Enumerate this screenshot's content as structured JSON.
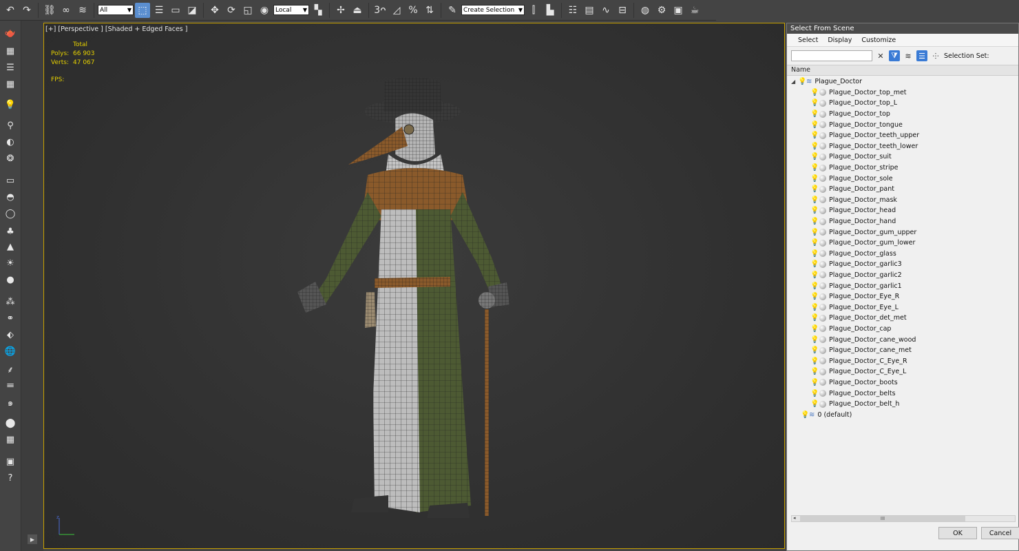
{
  "toolbar": {
    "filter_value": "All",
    "coord_value": "Local",
    "selection_set_placeholder": "Create Selection Se",
    "snap_label": "3",
    "angle_snap_label": "",
    "percent_snap_label": "%"
  },
  "viewport": {
    "label": "[+] [Perspective ] [Shaded + Edged Faces ]",
    "stats": {
      "header": "Total",
      "polys_label": "Polys:",
      "polys_value": "66 903",
      "verts_label": "Verts:",
      "verts_value": "47 067",
      "fps_label": "FPS:"
    },
    "axis_label": "z"
  },
  "dialog": {
    "title": "Select From Scene",
    "menu": [
      "Select",
      "Display",
      "Customize"
    ],
    "selection_set_label": "Selection Set:",
    "column_name": "Name",
    "root": "Plague_Doctor",
    "children": [
      "Plague_Doctor_top_met",
      "Plague_Doctor_top_L",
      "Plague_Doctor_top",
      "Plague_Doctor_tongue",
      "Plague_Doctor_teeth_upper",
      "Plague_Doctor_teeth_lower",
      "Plague_Doctor_suit",
      "Plague_Doctor_stripe",
      "Plague_Doctor_sole",
      "Plague_Doctor_pant",
      "Plague_Doctor_mask",
      "Plague_Doctor_head",
      "Plague_Doctor_hand",
      "Plague_Doctor_gum_upper",
      "Plague_Doctor_gum_lower",
      "Plague_Doctor_glass",
      "Plague_Doctor_garlic3",
      "Plague_Doctor_garlic2",
      "Plague_Doctor_garlic1",
      "Plague_Doctor_Eye_R",
      "Plague_Doctor_Eye_L",
      "Plague_Doctor_det_met",
      "Plague_Doctor_cap",
      "Plague_Doctor_cane_wood",
      "Plague_Doctor_cane_met",
      "Plague_Doctor_C_Eye_R",
      "Plague_Doctor_C_Eye_L",
      "Plague_Doctor_boots",
      "Plague_Doctor_belts",
      "Plague_Doctor_belt_h"
    ],
    "default_layer": "0 (default)",
    "scroll_thumb": "III",
    "ok_label": "OK",
    "cancel_label": "Cancel"
  },
  "colors": {
    "accent": "#5b8fd0",
    "viewport_border": "#c9a200",
    "stat_text": "#e6d100",
    "robe_green": "#4d5a33",
    "robe_white": "#bdbdbd",
    "leather": "#8a5a2b"
  }
}
